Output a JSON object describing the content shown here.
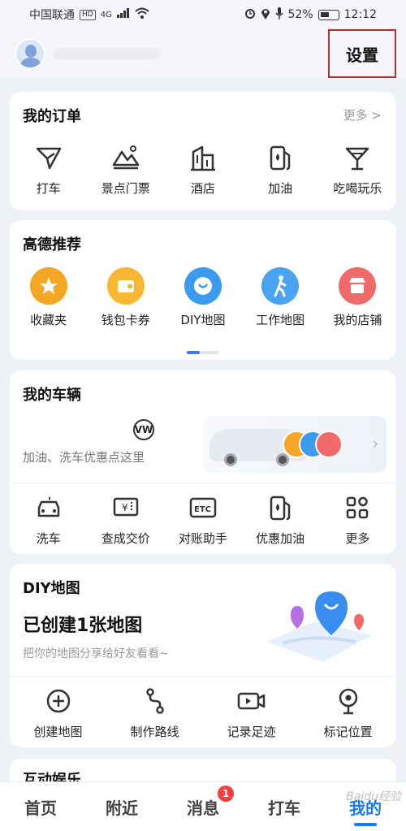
{
  "status_bar": {
    "carrier": "中国联通",
    "hd": "HD",
    "signal": "4G",
    "battery": "52%",
    "time": "12:12"
  },
  "header": {
    "settings_label": "设置"
  },
  "orders": {
    "title": "我的订单",
    "more": "更多 >",
    "items": [
      {
        "label": "打车",
        "icon": "taxi-icon"
      },
      {
        "label": "景点门票",
        "icon": "scenic-icon"
      },
      {
        "label": "酒店",
        "icon": "hotel-icon"
      },
      {
        "label": "加油",
        "icon": "fuel-icon"
      },
      {
        "label": "吃喝玩乐",
        "icon": "drink-icon"
      }
    ]
  },
  "recommend": {
    "title": "高德推荐",
    "items": [
      {
        "label": "收藏夹",
        "icon": "star-icon",
        "color": "#f5a623"
      },
      {
        "label": "钱包卡券",
        "icon": "wallet-icon",
        "color": "#f7b731"
      },
      {
        "label": "DIY地图",
        "icon": "diy-map-icon",
        "color": "#3a9bf0"
      },
      {
        "label": "工作地图",
        "icon": "walker-icon",
        "color": "#4aa3ef"
      },
      {
        "label": "我的店铺",
        "icon": "shop-icon",
        "color": "#f06a6a"
      }
    ]
  },
  "vehicle": {
    "title": "我的车辆",
    "promo_text": "加油、洗车优惠点这里",
    "items": [
      {
        "label": "洗车",
        "icon": "car-wash-icon"
      },
      {
        "label": "查成交价",
        "icon": "price-icon"
      },
      {
        "label": "对账助手",
        "icon": "etc-icon"
      },
      {
        "label": "优惠加油",
        "icon": "fuel-discount-icon"
      },
      {
        "label": "更多",
        "icon": "grid-icon"
      }
    ]
  },
  "diy_map": {
    "title": "DIY地图",
    "headline": "已创建1张地图",
    "subtitle": "把你的地图分享给好友看看~",
    "items": [
      {
        "label": "创建地图",
        "icon": "plus-circle-icon"
      },
      {
        "label": "制作路线",
        "icon": "route-icon"
      },
      {
        "label": "记录足迹",
        "icon": "video-icon"
      },
      {
        "label": "标记位置",
        "icon": "pin-icon"
      }
    ]
  },
  "peek_section": {
    "title": "互动娱乐"
  },
  "bottom_nav": {
    "items": [
      {
        "label": "首页"
      },
      {
        "label": "附近"
      },
      {
        "label": "消息",
        "badge": "1"
      },
      {
        "label": "打车"
      },
      {
        "label": "我的"
      }
    ]
  },
  "watermark": "Baidu经验",
  "colors": {
    "accent": "#1677ff",
    "badge": "#f53f3f",
    "highlight_box": "#b03030"
  }
}
